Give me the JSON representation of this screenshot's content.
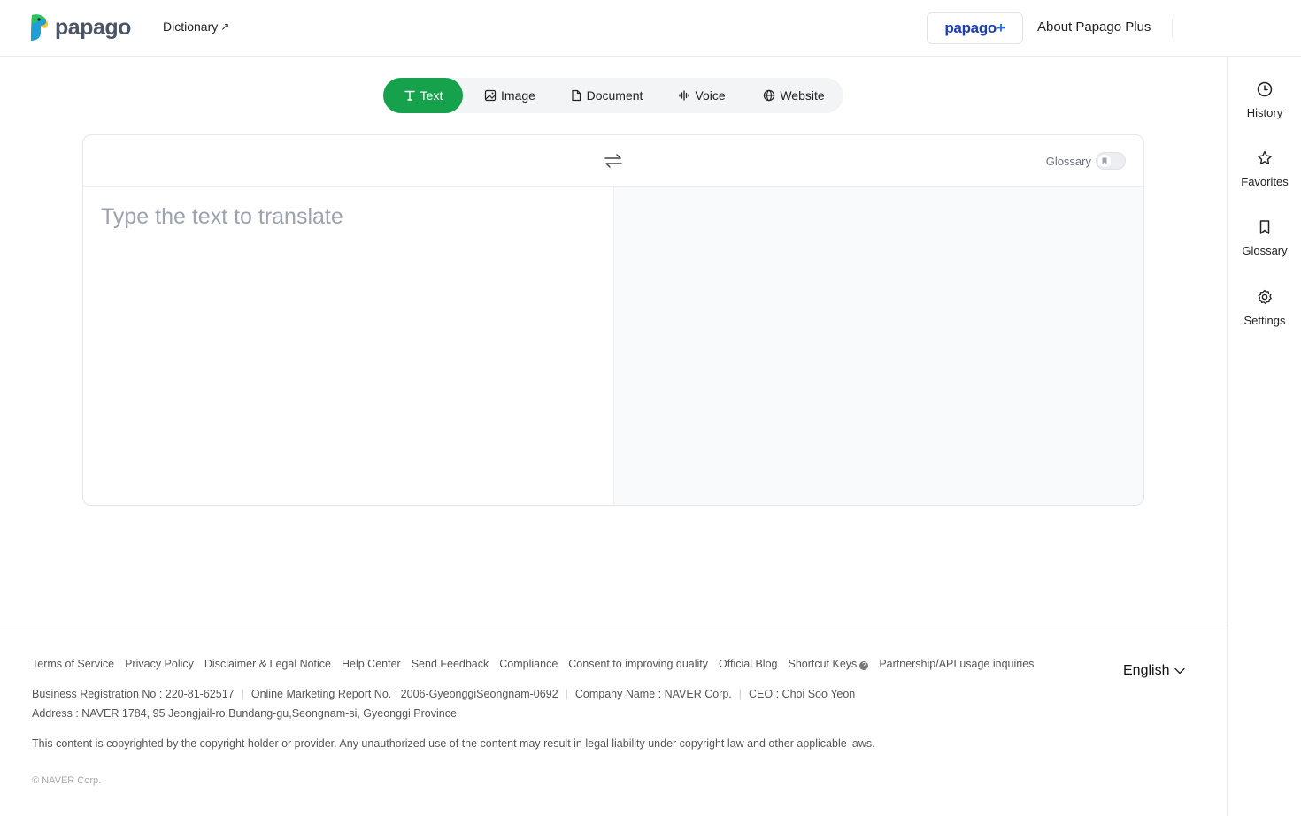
{
  "header": {
    "logo_text": "papago",
    "dictionary_label": "Dictionary",
    "plus_logo": "papago",
    "plus_sign": "+",
    "about_plus_label": "About Papago Plus"
  },
  "tabs": [
    {
      "label": "Text",
      "icon": "text-icon",
      "active": true
    },
    {
      "label": "Image",
      "icon": "image-icon",
      "active": false
    },
    {
      "label": "Document",
      "icon": "document-icon",
      "active": false
    },
    {
      "label": "Voice",
      "icon": "voice-icon",
      "active": false
    },
    {
      "label": "Website",
      "icon": "globe-icon",
      "active": false
    }
  ],
  "translator": {
    "placeholder": "Type the text to translate",
    "glossary_label": "Glossary",
    "glossary_enabled": false
  },
  "sidebar": {
    "items": [
      {
        "label": "History",
        "icon": "clock-icon"
      },
      {
        "label": "Favorites",
        "icon": "star-icon"
      },
      {
        "label": "Glossary",
        "icon": "bookmark-icon"
      },
      {
        "label": "Settings",
        "icon": "gear-icon"
      }
    ]
  },
  "footer": {
    "links": [
      "Terms of Service",
      "Privacy Policy",
      "Disclaimer & Legal Notice",
      "Help Center",
      "Send Feedback",
      "Compliance",
      "Consent to improving quality",
      "Official Blog",
      "Shortcut Keys",
      "Partnership/API usage inquiries"
    ],
    "language": "English",
    "business_reg": "Business Registration No : 220-81-62517",
    "marketing_report": "Online Marketing Report No. : 2006-GyeonggiSeongnam-0692",
    "company_name": "Company Name : NAVER Corp.",
    "ceo": "CEO : Choi Soo Yeon",
    "address": "Address : NAVER 1784, 95 Jeongjail-ro,Bundang-gu,Seongnam-si, Gyeonggi Province",
    "copyright_notice": "This content is copyrighted by the copyright holder or provider. Any unauthorized use of the content may result in legal liability under copyright law and other applicable laws.",
    "corp": "© NAVER Corp."
  },
  "colors": {
    "brand_green": "#16a14d",
    "plus_blue": "#1e3db3"
  }
}
